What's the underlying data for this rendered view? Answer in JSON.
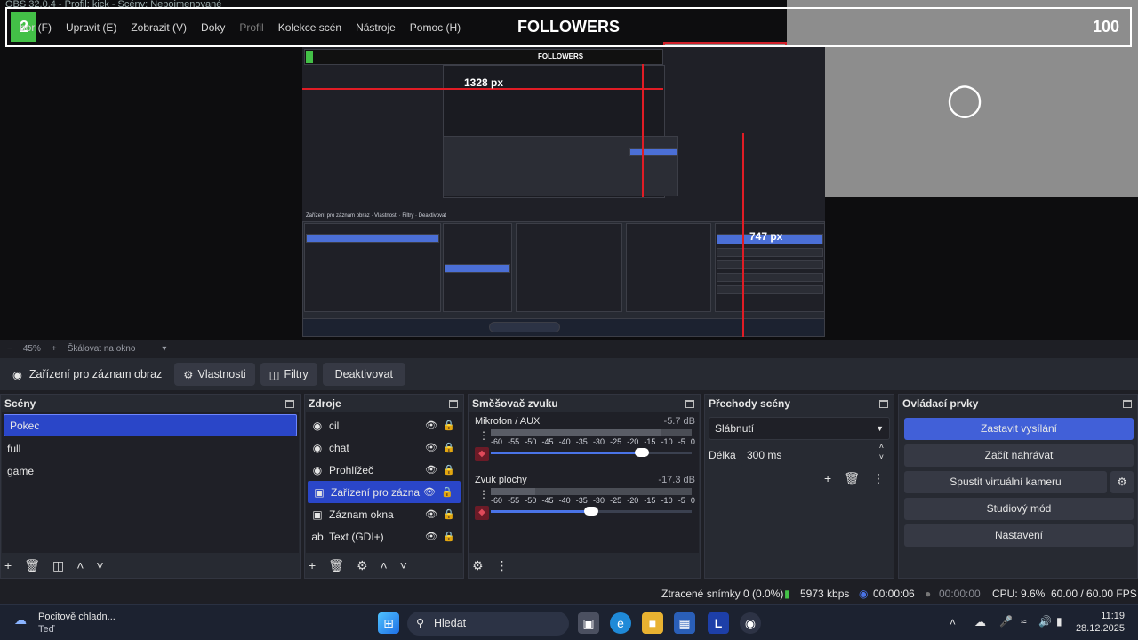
{
  "window": {
    "title": "OBS 32.0.4 - Profil: kick - Scény: Nepojmenované"
  },
  "menu": [
    "Soubor (F)",
    "Upravit (E)",
    "Zobrazit (V)",
    "Doky",
    "Profil",
    "Kolekce scén",
    "Nástroje",
    "Pomoc (H)"
  ],
  "menu_visible": [
    "bor (F)",
    "Upravit (E)",
    "Zobrazit (V)",
    "Doky",
    "Profil",
    "Kolekce scén",
    "Nástroje",
    "Pomoc (H)"
  ],
  "overlay": {
    "left_number": "2",
    "title": "FOLLOWERS",
    "value": "100",
    "progress_fraction": 0.02
  },
  "preview": {
    "measure_horizontal": "1328 px",
    "measure_vertical": "747 px"
  },
  "zoom": {
    "percent": "45%",
    "minus": "−",
    "plus": "+",
    "scale_mode": "Škálovat na okno"
  },
  "source_toolbar": {
    "current_source": "Zařízení pro záznam obraz",
    "properties": "Vlastnosti",
    "filters": "Filtry",
    "deactivate": "Deaktivovat"
  },
  "scenes": {
    "title": "Scény",
    "items": [
      "Pokec",
      "full",
      "game"
    ],
    "selected": "Pokec"
  },
  "sources": {
    "title": "Zdroje",
    "items": [
      {
        "name": "cil",
        "icon": "browser-icon"
      },
      {
        "name": "chat",
        "icon": "browser-icon"
      },
      {
        "name": "Prohlížeč",
        "icon": "browser-icon"
      },
      {
        "name": "Zařízení pro zázna",
        "icon": "camera-icon"
      },
      {
        "name": "Záznam okna",
        "icon": "window-icon"
      },
      {
        "name": "Text (GDI+)",
        "icon": "text-icon"
      }
    ],
    "selected": "Zařízení pro zázna"
  },
  "mixer": {
    "title": "Směšovač zvuku",
    "channels": [
      {
        "name": "Mikrofon / AUX",
        "db": "-5.7 dB",
        "volume": 0.75,
        "level": 0.85
      },
      {
        "name": "Zvuk plochy",
        "db": "-17.3 dB",
        "volume": 0.5,
        "level": 0.22
      }
    ],
    "ticks": [
      "-60",
      "-55",
      "-50",
      "-45",
      "-40",
      "-35",
      "-30",
      "-25",
      "-20",
      "-15",
      "-10",
      "-5",
      "0"
    ]
  },
  "transitions": {
    "title": "Přechody scény",
    "selected": "Slábnutí",
    "duration_label": "Délka",
    "duration_value": "300 ms"
  },
  "controls": {
    "title": "Ovládací prvky",
    "buttons": [
      "Zastavit vysílání",
      "Začít nahrávat",
      "Spustit virtuální kameru",
      "Studiový mód",
      "Nastavení"
    ]
  },
  "status": {
    "dropped": "Ztracené snímky 0 (0.0%)",
    "bitrate": "5973 kbps",
    "stream_time": "00:00:06",
    "rec_time": "00:00:00",
    "cpu": "CPU: 9.6%",
    "fps": "60.00 / 60.00 FPS"
  },
  "taskbar": {
    "weather_title": "Pocitově chladn...",
    "weather_sub": "Teď",
    "search": "Hledat",
    "time": "11:19",
    "date": "28.12.2025"
  },
  "colors": {
    "accent": "#4160d8",
    "selected": "#2a46c8",
    "overlay_green": "#43c047",
    "guide_red": "#e01c25"
  }
}
